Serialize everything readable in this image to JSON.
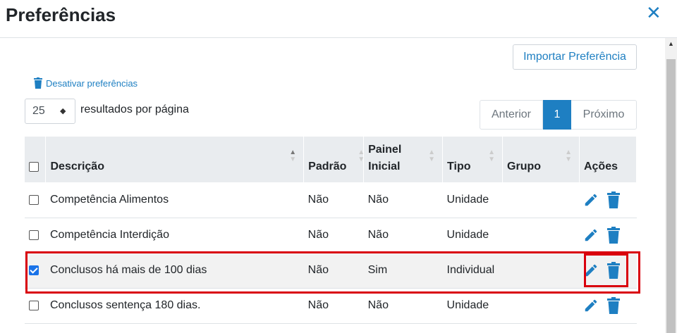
{
  "modal": {
    "title": "Preferências",
    "close_glyph": "✕"
  },
  "toolbar": {
    "import_label": "Importar Preferência",
    "deactivate_label": "Desativar preferências"
  },
  "pagination": {
    "per_page_value": "25",
    "per_page_label": "resultados por página",
    "prev_label": "Anterior",
    "current_page": "1",
    "next_label": "Próximo"
  },
  "table": {
    "headers": {
      "description": "Descrição",
      "default": "Padrão",
      "panel_line1": "Painel",
      "panel_line2": "Inicial",
      "type": "Tipo",
      "group": "Grupo",
      "actions": "Ações"
    },
    "rows": [
      {
        "checked": false,
        "description": "Competência Alimentos",
        "default": "Não",
        "panel": "Não",
        "type": "Unidade",
        "group": ""
      },
      {
        "checked": false,
        "description": "Competência Interdição",
        "default": "Não",
        "panel": "Não",
        "type": "Unidade",
        "group": ""
      },
      {
        "checked": true,
        "description": "Conclusos há mais de 100 dias",
        "default": "Não",
        "panel": "Sim",
        "type": "Individual",
        "group": ""
      },
      {
        "checked": false,
        "description": "Conclusos sentença 180 dias.",
        "default": "Não",
        "panel": "Não",
        "type": "Unidade",
        "group": ""
      }
    ]
  },
  "icons": {
    "edit": "pencil-icon",
    "delete": "trash-icon",
    "sort": "sort-icon"
  },
  "colors": {
    "accent": "#1e7fc2",
    "highlight": "#d9000d",
    "header_bg": "#e9ecef"
  }
}
